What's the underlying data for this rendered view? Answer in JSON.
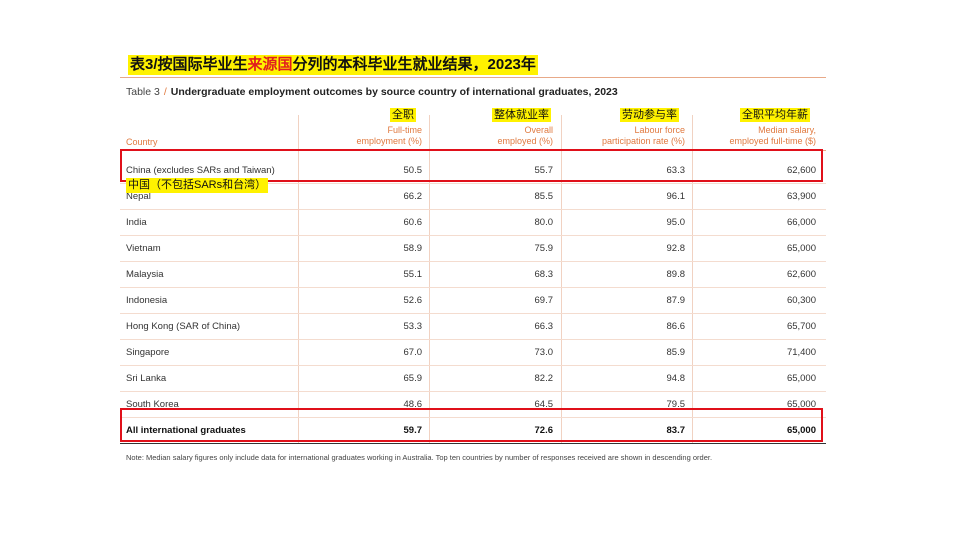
{
  "annotation_title": {
    "prefix": "表3/按国际毕业生",
    "highlight": "来源国",
    "suffix": "分列的本科毕业生就业结果，2023年"
  },
  "table_title": {
    "label": "Table 3",
    "separator": "/",
    "text": "Undergraduate employment outcomes by source country of international graduates, 2023"
  },
  "headers": {
    "country": "Country",
    "columns": [
      {
        "cn": "全职",
        "en_line1": "Full-time",
        "en_line2": "employment (%)"
      },
      {
        "cn": "整体就业率",
        "en_line1": "Overall",
        "en_line2": "employed (%)"
      },
      {
        "cn": "劳动参与率",
        "en_line1": "Labour force",
        "en_line2": "participation rate (%)"
      },
      {
        "cn": "全职平均年薪",
        "en_line1": "Median salary,",
        "en_line2": "employed full-time ($)"
      }
    ]
  },
  "rows": [
    {
      "country": "China (excludes SARs and Taiwan)",
      "full_time": "50.5",
      "overall": "55.7",
      "labour": "63.3",
      "salary": "62,600"
    },
    {
      "country": "Nepal",
      "full_time": "66.2",
      "overall": "85.5",
      "labour": "96.1",
      "salary": "63,900"
    },
    {
      "country": "India",
      "full_time": "60.6",
      "overall": "80.0",
      "labour": "95.0",
      "salary": "66,000"
    },
    {
      "country": "Vietnam",
      "full_time": "58.9",
      "overall": "75.9",
      "labour": "92.8",
      "salary": "65,000"
    },
    {
      "country": "Malaysia",
      "full_time": "55.1",
      "overall": "68.3",
      "labour": "89.8",
      "salary": "62,600"
    },
    {
      "country": "Indonesia",
      "full_time": "52.6",
      "overall": "69.7",
      "labour": "87.9",
      "salary": "60,300"
    },
    {
      "country": "Hong Kong (SAR of China)",
      "full_time": "53.3",
      "overall": "66.3",
      "labour": "86.6",
      "salary": "65,700"
    },
    {
      "country": "Singapore",
      "full_time": "67.0",
      "overall": "73.0",
      "labour": "85.9",
      "salary": "71,400"
    },
    {
      "country": "Sri Lanka",
      "full_time": "65.9",
      "overall": "82.2",
      "labour": "94.8",
      "salary": "65,000"
    },
    {
      "country": "South Korea",
      "full_time": "48.6",
      "overall": "64.5",
      "labour": "79.5",
      "salary": "65,000"
    }
  ],
  "total": {
    "country": "All international graduates",
    "full_time": "59.7",
    "overall": "72.6",
    "labour": "83.7",
    "salary": "65,000"
  },
  "china_label_cn": "中国（不包括SARs和台湾）",
  "note": "Note: Median salary figures only include data for international graduates working in Australia. Top ten countries by number of responses received are shown in descending order.",
  "colors": {
    "accent": "#e07a40",
    "highlight": "#fff200",
    "box": "#e0101a"
  }
}
